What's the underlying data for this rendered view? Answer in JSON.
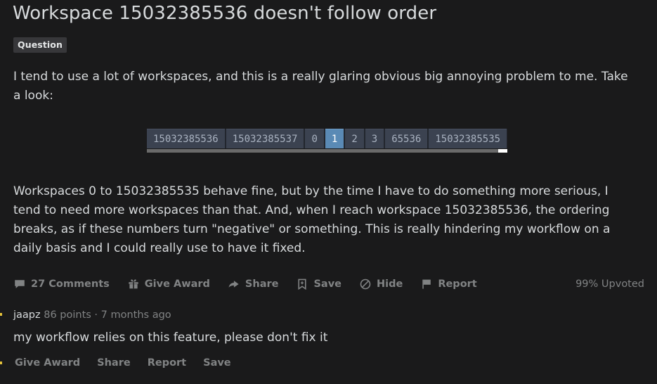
{
  "post": {
    "title": "Workspace 15032385536 doesn't follow order",
    "flair": "Question",
    "paragraph_1": "I tend to use a lot of workspaces, and this is a really glaring obvious big annoying problem to me. Take a look:",
    "paragraph_2": "Workspaces 0 to 15032385535 behave fine, but by the time I have to do something more serious, I tend to need more workspaces than that. And, when I reach workspace 15032385536, the ordering breaks, as if these numbers turn \"negative\" or something. This is really hindering my workflow on a daily basis and I could really use to have it fixed.",
    "upvoted": "99% Upvoted"
  },
  "embed": {
    "workspaces": [
      {
        "label": "15032385536",
        "active": false
      },
      {
        "label": "15032385537",
        "active": false
      },
      {
        "label": "0",
        "active": false
      },
      {
        "label": "1",
        "active": true
      },
      {
        "label": "2",
        "active": false
      },
      {
        "label": "3",
        "active": false
      },
      {
        "label": "65536",
        "active": false
      },
      {
        "label": "15032385535",
        "active": false
      }
    ],
    "colors": {
      "bar_background": "#22262e",
      "cell_background": "#3b4250",
      "cell_text": "#a9b2c0",
      "active_background": "#5a8ab5",
      "active_text": "#ffffff",
      "scrollbar_track": "#6a6a6a",
      "scrollbar_thumb": "#ffffff"
    }
  },
  "actions": [
    {
      "label": "27 Comments",
      "icon": "comment-bubble-icon"
    },
    {
      "label": "Give Award",
      "icon": "gift-icon"
    },
    {
      "label": "Share",
      "icon": "share-arrow-icon"
    },
    {
      "label": "Save",
      "icon": "bookmark-icon"
    },
    {
      "label": "Hide",
      "icon": "circle-slash-icon"
    },
    {
      "label": "Report",
      "icon": "flag-icon"
    }
  ],
  "comment": {
    "author": "jaapz",
    "meta": "86 points · 7 months ago",
    "text": "my workflow relies on this feature, please don't fix it",
    "actions": [
      {
        "label": "Give Award"
      },
      {
        "label": "Share"
      },
      {
        "label": "Report"
      },
      {
        "label": "Save"
      }
    ],
    "thread_line_color": "#e3c13a"
  },
  "theme": {
    "background": "#1a1a1b",
    "text_primary": "#d7dadc",
    "text_muted": "#818384",
    "flair_background": "#37373a"
  }
}
